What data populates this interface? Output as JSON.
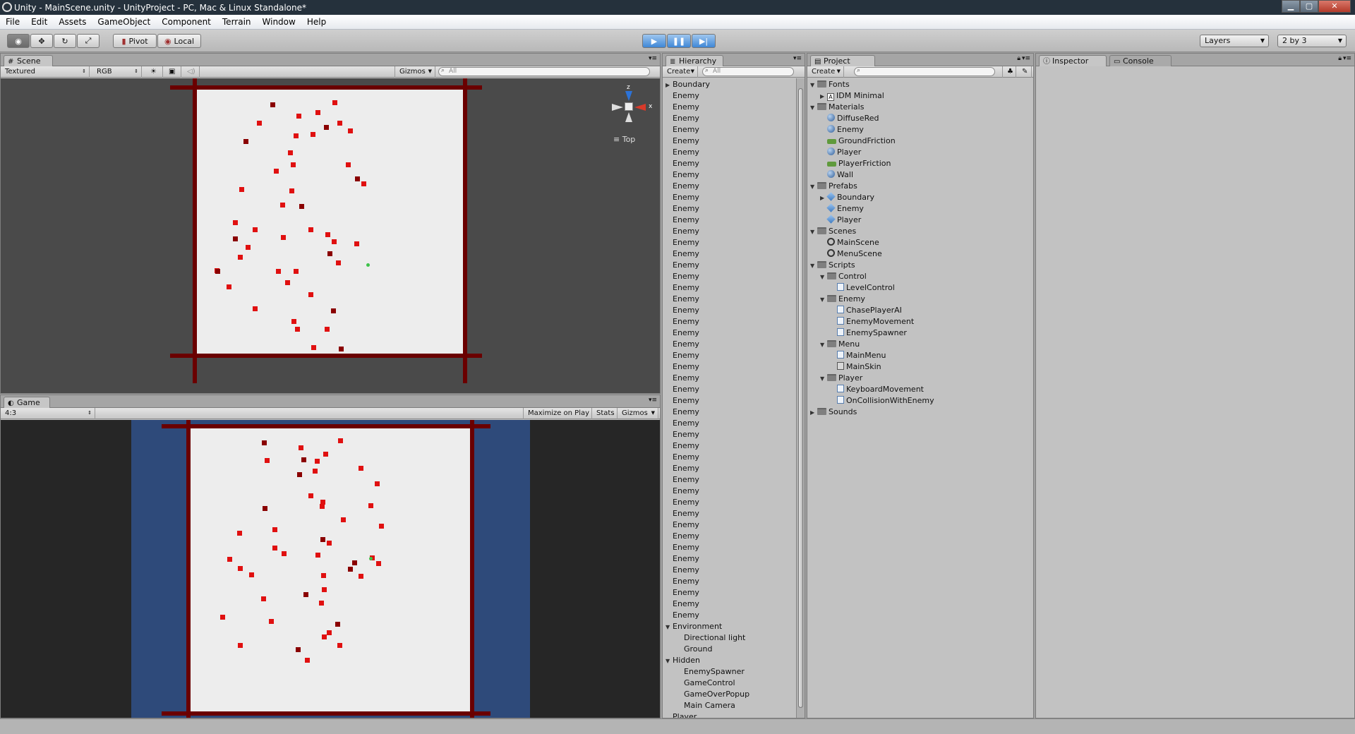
{
  "window": {
    "title": "Unity - MainScene.unity - UnityProject - PC, Mac & Linux Standalone*"
  },
  "menu": [
    "File",
    "Edit",
    "Assets",
    "GameObject",
    "Component",
    "Terrain",
    "Window",
    "Help"
  ],
  "toolbar": {
    "pivot_label": "Pivot",
    "local_label": "Local",
    "layers_label": "Layers",
    "layout_label": "2 by 3"
  },
  "scene": {
    "tab_label": "Scene",
    "render_mode": "Textured",
    "channel": "RGB",
    "gizmos_label": "Gizmos",
    "search_placeholder": "All",
    "axis_label": "Top",
    "axis_z": "z",
    "axis_x": "x"
  },
  "game": {
    "tab_label": "Game",
    "aspect": "4:3",
    "maximize_label": "Maximize on Play",
    "stats_label": "Stats",
    "gizmos_label": "Gizmos"
  },
  "hierarchy": {
    "tab_label": "Hierarchy",
    "create_label": "Create",
    "search_placeholder": "All",
    "items": [
      {
        "label": "Boundary",
        "indent": 0,
        "arrow": "right"
      },
      {
        "label": "Enemy",
        "indent": 0
      },
      {
        "label": "Enemy",
        "indent": 0
      },
      {
        "label": "Enemy",
        "indent": 0
      },
      {
        "label": "Enemy",
        "indent": 0
      },
      {
        "label": "Enemy",
        "indent": 0
      },
      {
        "label": "Enemy",
        "indent": 0
      },
      {
        "label": "Enemy",
        "indent": 0
      },
      {
        "label": "Enemy",
        "indent": 0
      },
      {
        "label": "Enemy",
        "indent": 0
      },
      {
        "label": "Enemy",
        "indent": 0
      },
      {
        "label": "Enemy",
        "indent": 0
      },
      {
        "label": "Enemy",
        "indent": 0
      },
      {
        "label": "Enemy",
        "indent": 0
      },
      {
        "label": "Enemy",
        "indent": 0
      },
      {
        "label": "Enemy",
        "indent": 0
      },
      {
        "label": "Enemy",
        "indent": 0
      },
      {
        "label": "Enemy",
        "indent": 0
      },
      {
        "label": "Enemy",
        "indent": 0
      },
      {
        "label": "Enemy",
        "indent": 0
      },
      {
        "label": "Enemy",
        "indent": 0
      },
      {
        "label": "Enemy",
        "indent": 0
      },
      {
        "label": "Enemy",
        "indent": 0
      },
      {
        "label": "Enemy",
        "indent": 0
      },
      {
        "label": "Enemy",
        "indent": 0
      },
      {
        "label": "Enemy",
        "indent": 0
      },
      {
        "label": "Enemy",
        "indent": 0
      },
      {
        "label": "Enemy",
        "indent": 0
      },
      {
        "label": "Enemy",
        "indent": 0
      },
      {
        "label": "Enemy",
        "indent": 0
      },
      {
        "label": "Enemy",
        "indent": 0
      },
      {
        "label": "Enemy",
        "indent": 0
      },
      {
        "label": "Enemy",
        "indent": 0
      },
      {
        "label": "Enemy",
        "indent": 0
      },
      {
        "label": "Enemy",
        "indent": 0
      },
      {
        "label": "Enemy",
        "indent": 0
      },
      {
        "label": "Enemy",
        "indent": 0
      },
      {
        "label": "Enemy",
        "indent": 0
      },
      {
        "label": "Enemy",
        "indent": 0
      },
      {
        "label": "Enemy",
        "indent": 0
      },
      {
        "label": "Enemy",
        "indent": 0
      },
      {
        "label": "Enemy",
        "indent": 0
      },
      {
        "label": "Enemy",
        "indent": 0
      },
      {
        "label": "Enemy",
        "indent": 0
      },
      {
        "label": "Enemy",
        "indent": 0
      },
      {
        "label": "Enemy",
        "indent": 0
      },
      {
        "label": "Enemy",
        "indent": 0
      },
      {
        "label": "Enemy",
        "indent": 0
      },
      {
        "label": "Environment",
        "indent": 0,
        "arrow": "down"
      },
      {
        "label": "Directional light",
        "indent": 1
      },
      {
        "label": "Ground",
        "indent": 1
      },
      {
        "label": "Hidden",
        "indent": 0,
        "arrow": "down"
      },
      {
        "label": "EnemySpawner",
        "indent": 1
      },
      {
        "label": "GameControl",
        "indent": 1
      },
      {
        "label": "GameOverPopup",
        "indent": 1
      },
      {
        "label": "Main Camera",
        "indent": 1
      },
      {
        "label": "Player",
        "indent": 0
      }
    ]
  },
  "project": {
    "tab_label": "Project",
    "create_label": "Create",
    "items": [
      {
        "label": "Fonts",
        "indent": 0,
        "arrow": "down",
        "icon": "folder"
      },
      {
        "label": "IDM Minimal",
        "indent": 1,
        "arrow": "right",
        "icon": "font"
      },
      {
        "label": "Materials",
        "indent": 0,
        "arrow": "down",
        "icon": "folder"
      },
      {
        "label": "DiffuseRed",
        "indent": 1,
        "icon": "sphere"
      },
      {
        "label": "Enemy",
        "indent": 1,
        "icon": "sphere"
      },
      {
        "label": "GroundFriction",
        "indent": 1,
        "icon": "phys"
      },
      {
        "label": "Player",
        "indent": 1,
        "icon": "sphere"
      },
      {
        "label": "PlayerFriction",
        "indent": 1,
        "icon": "phys"
      },
      {
        "label": "Wall",
        "indent": 1,
        "icon": "sphere"
      },
      {
        "label": "Prefabs",
        "indent": 0,
        "arrow": "down",
        "icon": "folder"
      },
      {
        "label": "Boundary",
        "indent": 1,
        "arrow": "right",
        "icon": "cube"
      },
      {
        "label": "Enemy",
        "indent": 1,
        "icon": "cube"
      },
      {
        "label": "Player",
        "indent": 1,
        "icon": "cube"
      },
      {
        "label": "Scenes",
        "indent": 0,
        "arrow": "down",
        "icon": "folder"
      },
      {
        "label": "MainScene",
        "indent": 1,
        "icon": "scene"
      },
      {
        "label": "MenuScene",
        "indent": 1,
        "icon": "scene"
      },
      {
        "label": "Scripts",
        "indent": 0,
        "arrow": "down",
        "icon": "folder"
      },
      {
        "label": "Control",
        "indent": 1,
        "arrow": "down",
        "icon": "folder"
      },
      {
        "label": "LevelControl",
        "indent": 2,
        "icon": "script"
      },
      {
        "label": "Enemy",
        "indent": 1,
        "arrow": "down",
        "icon": "folder"
      },
      {
        "label": "ChasePlayerAI",
        "indent": 2,
        "icon": "script"
      },
      {
        "label": "EnemyMovement",
        "indent": 2,
        "icon": "script"
      },
      {
        "label": "EnemySpawner",
        "indent": 2,
        "icon": "script"
      },
      {
        "label": "Menu",
        "indent": 1,
        "arrow": "down",
        "icon": "folder"
      },
      {
        "label": "MainMenu",
        "indent": 2,
        "icon": "script"
      },
      {
        "label": "MainSkin",
        "indent": 2,
        "icon": "skin"
      },
      {
        "label": "Player",
        "indent": 1,
        "arrow": "down",
        "icon": "folder"
      },
      {
        "label": "KeyboardMovement",
        "indent": 2,
        "icon": "script"
      },
      {
        "label": "OnCollisionWithEnemy",
        "indent": 2,
        "icon": "script"
      },
      {
        "label": "Sounds",
        "indent": 0,
        "arrow": "right",
        "icon": "folder"
      }
    ]
  },
  "inspector": {
    "tab_label": "Inspector",
    "console_label": "Console"
  },
  "colors": {
    "wall": "#6a0000",
    "enemy": "#e01010",
    "player": "#3ec24a",
    "game_bg": "#2e4a7a",
    "scene_bg": "#4a4a4a"
  }
}
